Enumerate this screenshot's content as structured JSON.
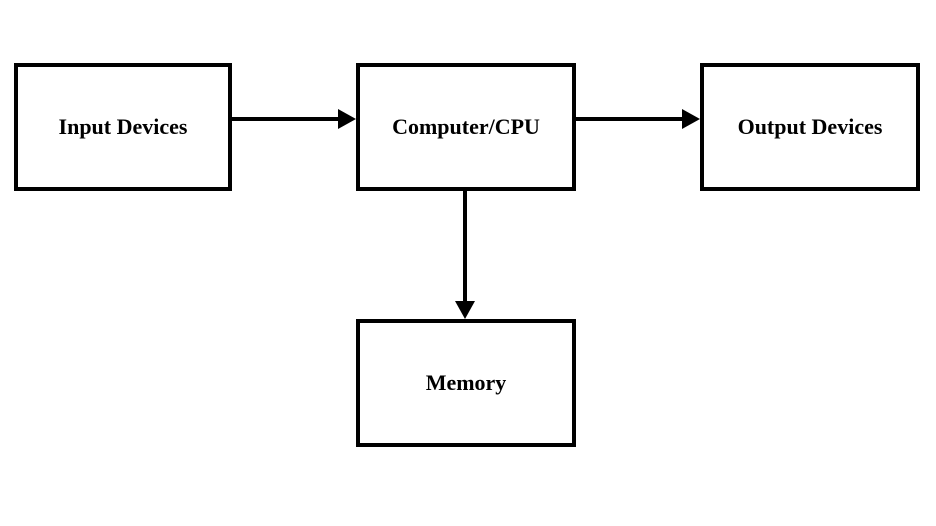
{
  "boxes": {
    "input": "Input Devices",
    "cpu": "Computer/CPU",
    "output": "Output Devices",
    "memory": "Memory"
  }
}
